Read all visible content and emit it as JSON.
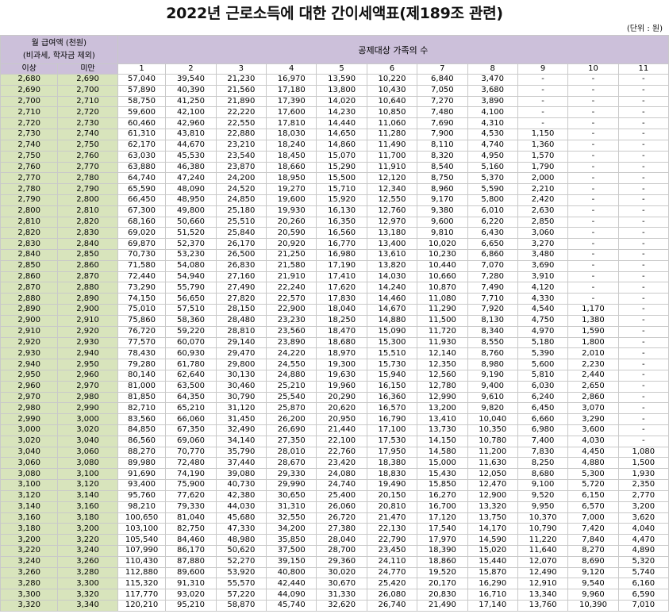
{
  "title": "2022년 근로소득에 대한 간이세액표(제189조 관련)",
  "unit_note": "(단위 : 원)",
  "header": {
    "salary_label_line1": "월 급여액 (천원)",
    "salary_label_line2": "(비과세, 학자금 제외)",
    "dependents_label": "공제대상 가족의 수",
    "lower_label": "이상",
    "upper_label": "미만",
    "family_counts": [
      "1",
      "2",
      "3",
      "4",
      "5",
      "6",
      "7",
      "8",
      "9",
      "10",
      "11"
    ]
  },
  "rows": [
    [
      "2,680",
      "2,690",
      "57,040",
      "39,540",
      "21,230",
      "16,970",
      "13,590",
      "10,220",
      "6,840",
      "3,470",
      "-",
      "-",
      "-"
    ],
    [
      "2,690",
      "2,700",
      "57,890",
      "40,390",
      "21,560",
      "17,180",
      "13,800",
      "10,430",
      "7,050",
      "3,680",
      "-",
      "-",
      "-"
    ],
    [
      "2,700",
      "2,710",
      "58,750",
      "41,250",
      "21,890",
      "17,390",
      "14,020",
      "10,640",
      "7,270",
      "3,890",
      "-",
      "-",
      "-"
    ],
    [
      "2,710",
      "2,720",
      "59,600",
      "42,100",
      "22,220",
      "17,600",
      "14,230",
      "10,850",
      "7,480",
      "4,100",
      "-",
      "-",
      "-"
    ],
    [
      "2,720",
      "2,730",
      "60,460",
      "42,960",
      "22,550",
      "17,810",
      "14,440",
      "11,060",
      "7,690",
      "4,310",
      "-",
      "-",
      "-"
    ],
    [
      "2,730",
      "2,740",
      "61,310",
      "43,810",
      "22,880",
      "18,030",
      "14,650",
      "11,280",
      "7,900",
      "4,530",
      "1,150",
      "-",
      "-"
    ],
    [
      "2,740",
      "2,750",
      "62,170",
      "44,670",
      "23,210",
      "18,240",
      "14,860",
      "11,490",
      "8,110",
      "4,740",
      "1,360",
      "-",
      "-"
    ],
    [
      "2,750",
      "2,760",
      "63,030",
      "45,530",
      "23,540",
      "18,450",
      "15,070",
      "11,700",
      "8,320",
      "4,950",
      "1,570",
      "-",
      "-"
    ],
    [
      "2,760",
      "2,770",
      "63,880",
      "46,380",
      "23,870",
      "18,660",
      "15,290",
      "11,910",
      "8,540",
      "5,160",
      "1,790",
      "-",
      "-"
    ],
    [
      "2,770",
      "2,780",
      "64,740",
      "47,240",
      "24,200",
      "18,950",
      "15,500",
      "12,120",
      "8,750",
      "5,370",
      "2,000",
      "-",
      "-"
    ],
    [
      "2,780",
      "2,790",
      "65,590",
      "48,090",
      "24,520",
      "19,270",
      "15,710",
      "12,340",
      "8,960",
      "5,590",
      "2,210",
      "-",
      "-"
    ],
    [
      "2,790",
      "2,800",
      "66,450",
      "48,950",
      "24,850",
      "19,600",
      "15,920",
      "12,550",
      "9,170",
      "5,800",
      "2,420",
      "-",
      "-"
    ],
    [
      "2,800",
      "2,810",
      "67,300",
      "49,800",
      "25,180",
      "19,930",
      "16,130",
      "12,760",
      "9,380",
      "6,010",
      "2,630",
      "-",
      "-"
    ],
    [
      "2,810",
      "2,820",
      "68,160",
      "50,660",
      "25,510",
      "20,260",
      "16,350",
      "12,970",
      "9,600",
      "6,220",
      "2,850",
      "-",
      "-"
    ],
    [
      "2,820",
      "2,830",
      "69,020",
      "51,520",
      "25,840",
      "20,590",
      "16,560",
      "13,180",
      "9,810",
      "6,430",
      "3,060",
      "-",
      "-"
    ],
    [
      "2,830",
      "2,840",
      "69,870",
      "52,370",
      "26,170",
      "20,920",
      "16,770",
      "13,400",
      "10,020",
      "6,650",
      "3,270",
      "-",
      "-"
    ],
    [
      "2,840",
      "2,850",
      "70,730",
      "53,230",
      "26,500",
      "21,250",
      "16,980",
      "13,610",
      "10,230",
      "6,860",
      "3,480",
      "-",
      "-"
    ],
    [
      "2,850",
      "2,860",
      "71,580",
      "54,080",
      "26,830",
      "21,580",
      "17,190",
      "13,820",
      "10,440",
      "7,070",
      "3,690",
      "-",
      "-"
    ],
    [
      "2,860",
      "2,870",
      "72,440",
      "54,940",
      "27,160",
      "21,910",
      "17,410",
      "14,030",
      "10,660",
      "7,280",
      "3,910",
      "-",
      "-"
    ],
    [
      "2,870",
      "2,880",
      "73,290",
      "55,790",
      "27,490",
      "22,240",
      "17,620",
      "14,240",
      "10,870",
      "7,490",
      "4,120",
      "-",
      "-"
    ],
    [
      "2,880",
      "2,890",
      "74,150",
      "56,650",
      "27,820",
      "22,570",
      "17,830",
      "14,460",
      "11,080",
      "7,710",
      "4,330",
      "-",
      "-"
    ],
    [
      "2,890",
      "2,900",
      "75,010",
      "57,510",
      "28,150",
      "22,900",
      "18,040",
      "14,670",
      "11,290",
      "7,920",
      "4,540",
      "1,170",
      "-"
    ],
    [
      "2,900",
      "2,910",
      "75,860",
      "58,360",
      "28,480",
      "23,230",
      "18,250",
      "14,880",
      "11,500",
      "8,130",
      "4,750",
      "1,380",
      "-"
    ],
    [
      "2,910",
      "2,920",
      "76,720",
      "59,220",
      "28,810",
      "23,560",
      "18,470",
      "15,090",
      "11,720",
      "8,340",
      "4,970",
      "1,590",
      "-"
    ],
    [
      "2,920",
      "2,930",
      "77,570",
      "60,070",
      "29,140",
      "23,890",
      "18,680",
      "15,300",
      "11,930",
      "8,550",
      "5,180",
      "1,800",
      "-"
    ],
    [
      "2,930",
      "2,940",
      "78,430",
      "60,930",
      "29,470",
      "24,220",
      "18,970",
      "15,510",
      "12,140",
      "8,760",
      "5,390",
      "2,010",
      "-"
    ],
    [
      "2,940",
      "2,950",
      "79,280",
      "61,780",
      "29,800",
      "24,550",
      "19,300",
      "15,730",
      "12,350",
      "8,980",
      "5,600",
      "2,230",
      "-"
    ],
    [
      "2,950",
      "2,960",
      "80,140",
      "62,640",
      "30,130",
      "24,880",
      "19,630",
      "15,940",
      "12,560",
      "9,190",
      "5,810",
      "2,440",
      "-"
    ],
    [
      "2,960",
      "2,970",
      "81,000",
      "63,500",
      "30,460",
      "25,210",
      "19,960",
      "16,150",
      "12,780",
      "9,400",
      "6,030",
      "2,650",
      "-"
    ],
    [
      "2,970",
      "2,980",
      "81,850",
      "64,350",
      "30,790",
      "25,540",
      "20,290",
      "16,360",
      "12,990",
      "9,610",
      "6,240",
      "2,860",
      "-"
    ],
    [
      "2,980",
      "2,990",
      "82,710",
      "65,210",
      "31,120",
      "25,870",
      "20,620",
      "16,570",
      "13,200",
      "9,820",
      "6,450",
      "3,070",
      "-"
    ],
    [
      "2,990",
      "3,000",
      "83,560",
      "66,060",
      "31,450",
      "26,200",
      "20,950",
      "16,790",
      "13,410",
      "10,040",
      "6,660",
      "3,290",
      "-"
    ],
    [
      "3,000",
      "3,020",
      "84,850",
      "67,350",
      "32,490",
      "26,690",
      "21,440",
      "17,100",
      "13,730",
      "10,350",
      "6,980",
      "3,600",
      "-"
    ],
    [
      "3,020",
      "3,040",
      "86,560",
      "69,060",
      "34,140",
      "27,350",
      "22,100",
      "17,530",
      "14,150",
      "10,780",
      "7,400",
      "4,030",
      "-"
    ],
    [
      "3,040",
      "3,060",
      "88,270",
      "70,770",
      "35,790",
      "28,010",
      "22,760",
      "17,950",
      "14,580",
      "11,200",
      "7,830",
      "4,450",
      "1,080"
    ],
    [
      "3,060",
      "3,080",
      "89,980",
      "72,480",
      "37,440",
      "28,670",
      "23,420",
      "18,380",
      "15,000",
      "11,630",
      "8,250",
      "4,880",
      "1,500"
    ],
    [
      "3,080",
      "3,100",
      "91,690",
      "74,190",
      "39,080",
      "29,330",
      "24,080",
      "18,830",
      "15,430",
      "12,050",
      "8,680",
      "5,300",
      "1,930"
    ],
    [
      "3,100",
      "3,120",
      "93,400",
      "75,900",
      "40,730",
      "29,990",
      "24,740",
      "19,490",
      "15,850",
      "12,470",
      "9,100",
      "5,720",
      "2,350"
    ],
    [
      "3,120",
      "3,140",
      "95,760",
      "77,620",
      "42,380",
      "30,650",
      "25,400",
      "20,150",
      "16,270",
      "12,900",
      "9,520",
      "6,150",
      "2,770"
    ],
    [
      "3,140",
      "3,160",
      "98,210",
      "79,330",
      "44,030",
      "31,310",
      "26,060",
      "20,810",
      "16,700",
      "13,320",
      "9,950",
      "6,570",
      "3,200"
    ],
    [
      "3,160",
      "3,180",
      "100,650",
      "81,040",
      "45,680",
      "32,550",
      "26,720",
      "21,470",
      "17,120",
      "13,750",
      "10,370",
      "7,000",
      "3,620"
    ],
    [
      "3,180",
      "3,200",
      "103,100",
      "82,750",
      "47,330",
      "34,200",
      "27,380",
      "22,130",
      "17,540",
      "14,170",
      "10,790",
      "7,420",
      "4,040"
    ],
    [
      "3,200",
      "3,220",
      "105,540",
      "84,460",
      "48,980",
      "35,850",
      "28,040",
      "22,790",
      "17,970",
      "14,590",
      "11,220",
      "7,840",
      "4,470"
    ],
    [
      "3,220",
      "3,240",
      "107,990",
      "86,170",
      "50,620",
      "37,500",
      "28,700",
      "23,450",
      "18,390",
      "15,020",
      "11,640",
      "8,270",
      "4,890"
    ],
    [
      "3,240",
      "3,260",
      "110,430",
      "87,880",
      "52,270",
      "39,150",
      "29,360",
      "24,110",
      "18,860",
      "15,440",
      "12,070",
      "8,690",
      "5,320"
    ],
    [
      "3,260",
      "3,280",
      "112,880",
      "89,600",
      "53,920",
      "40,800",
      "30,020",
      "24,770",
      "19,520",
      "15,870",
      "12,490",
      "9,120",
      "5,740"
    ],
    [
      "3,280",
      "3,300",
      "115,320",
      "91,310",
      "55,570",
      "42,440",
      "30,670",
      "25,420",
      "20,170",
      "16,290",
      "12,910",
      "9,540",
      "6,160"
    ],
    [
      "3,300",
      "3,320",
      "117,770",
      "93,020",
      "57,220",
      "44,090",
      "31,330",
      "26,080",
      "20,830",
      "16,710",
      "13,340",
      "9,960",
      "6,590"
    ],
    [
      "3,320",
      "3,340",
      "120,210",
      "95,210",
      "58,870",
      "45,740",
      "32,620",
      "26,740",
      "21,490",
      "17,140",
      "13,760",
      "10,390",
      "7,010"
    ]
  ]
}
